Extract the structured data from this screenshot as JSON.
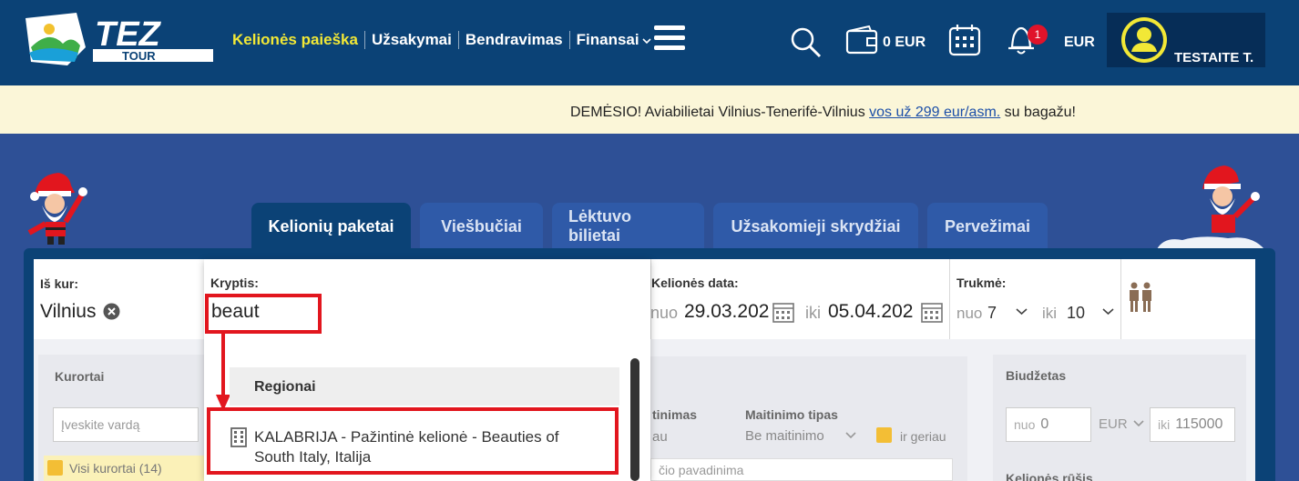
{
  "header": {
    "nav": [
      "Kelionės paieška",
      "Užsakymai",
      "Bendravimas",
      "Finansai"
    ],
    "wallet": "0 EUR",
    "notifications_count": "1",
    "currency": "EUR",
    "user_name": "TESTAITE T."
  },
  "notice": {
    "prefix": "DEMĖSIO! Aviabilietai Vilnius-Tenerifė-Vilnius ",
    "link": "vos už 299 eur/asm.",
    "suffix": " su bagažu!"
  },
  "tabs": [
    "Kelionių paketai",
    "Viešbučiai",
    "Lėktuvo bilietai",
    "Užsakomieji skrydžiai",
    "Pervežimai"
  ],
  "form": {
    "from_label": "Iš kur:",
    "from_value": "Vilnius",
    "direction_label": "Kryptis:",
    "direction_value": "beaut",
    "date_label": "Kelionės data:",
    "date_from_prefix": "nuo",
    "date_from": "29.03.202",
    "date_to_prefix": "iki",
    "date_to": "05.04.202",
    "duration_label": "Trukmė:",
    "dur_from_prefix": "nuo",
    "dur_from": "7",
    "dur_to_prefix": "iki",
    "dur_to": "10"
  },
  "dropdown": {
    "section": "Regionai",
    "item": "KALABRIJA - Pažintinė kelionė - Beauties of South Italy, Italija"
  },
  "lower": {
    "resorts_label": "Kurortai",
    "resorts_placeholder": "Įveskite vardą",
    "all_resorts": "Visi kurortai (14)",
    "meal_label": "tinimas",
    "meal_sub": "au",
    "meal_type_label": "Maitinimo tipas",
    "meal_type_value": "Be maitinimo",
    "or_better": "ir geriau",
    "hotel_name_placeholder": "čio pavadinima",
    "budget_label": "Biudžetas",
    "budget_from_prefix": "nuo",
    "budget_from": "0",
    "budget_cur": "EUR",
    "budget_to_prefix": "iki",
    "budget_to": "115000",
    "tour_sort_label": "Kelionės rūšis"
  },
  "colors": {
    "header_bg": "#0b4276",
    "accent_yellow": "#f2e836",
    "highlight_red": "#e2161e",
    "notice_bg": "#fbf6d8"
  }
}
